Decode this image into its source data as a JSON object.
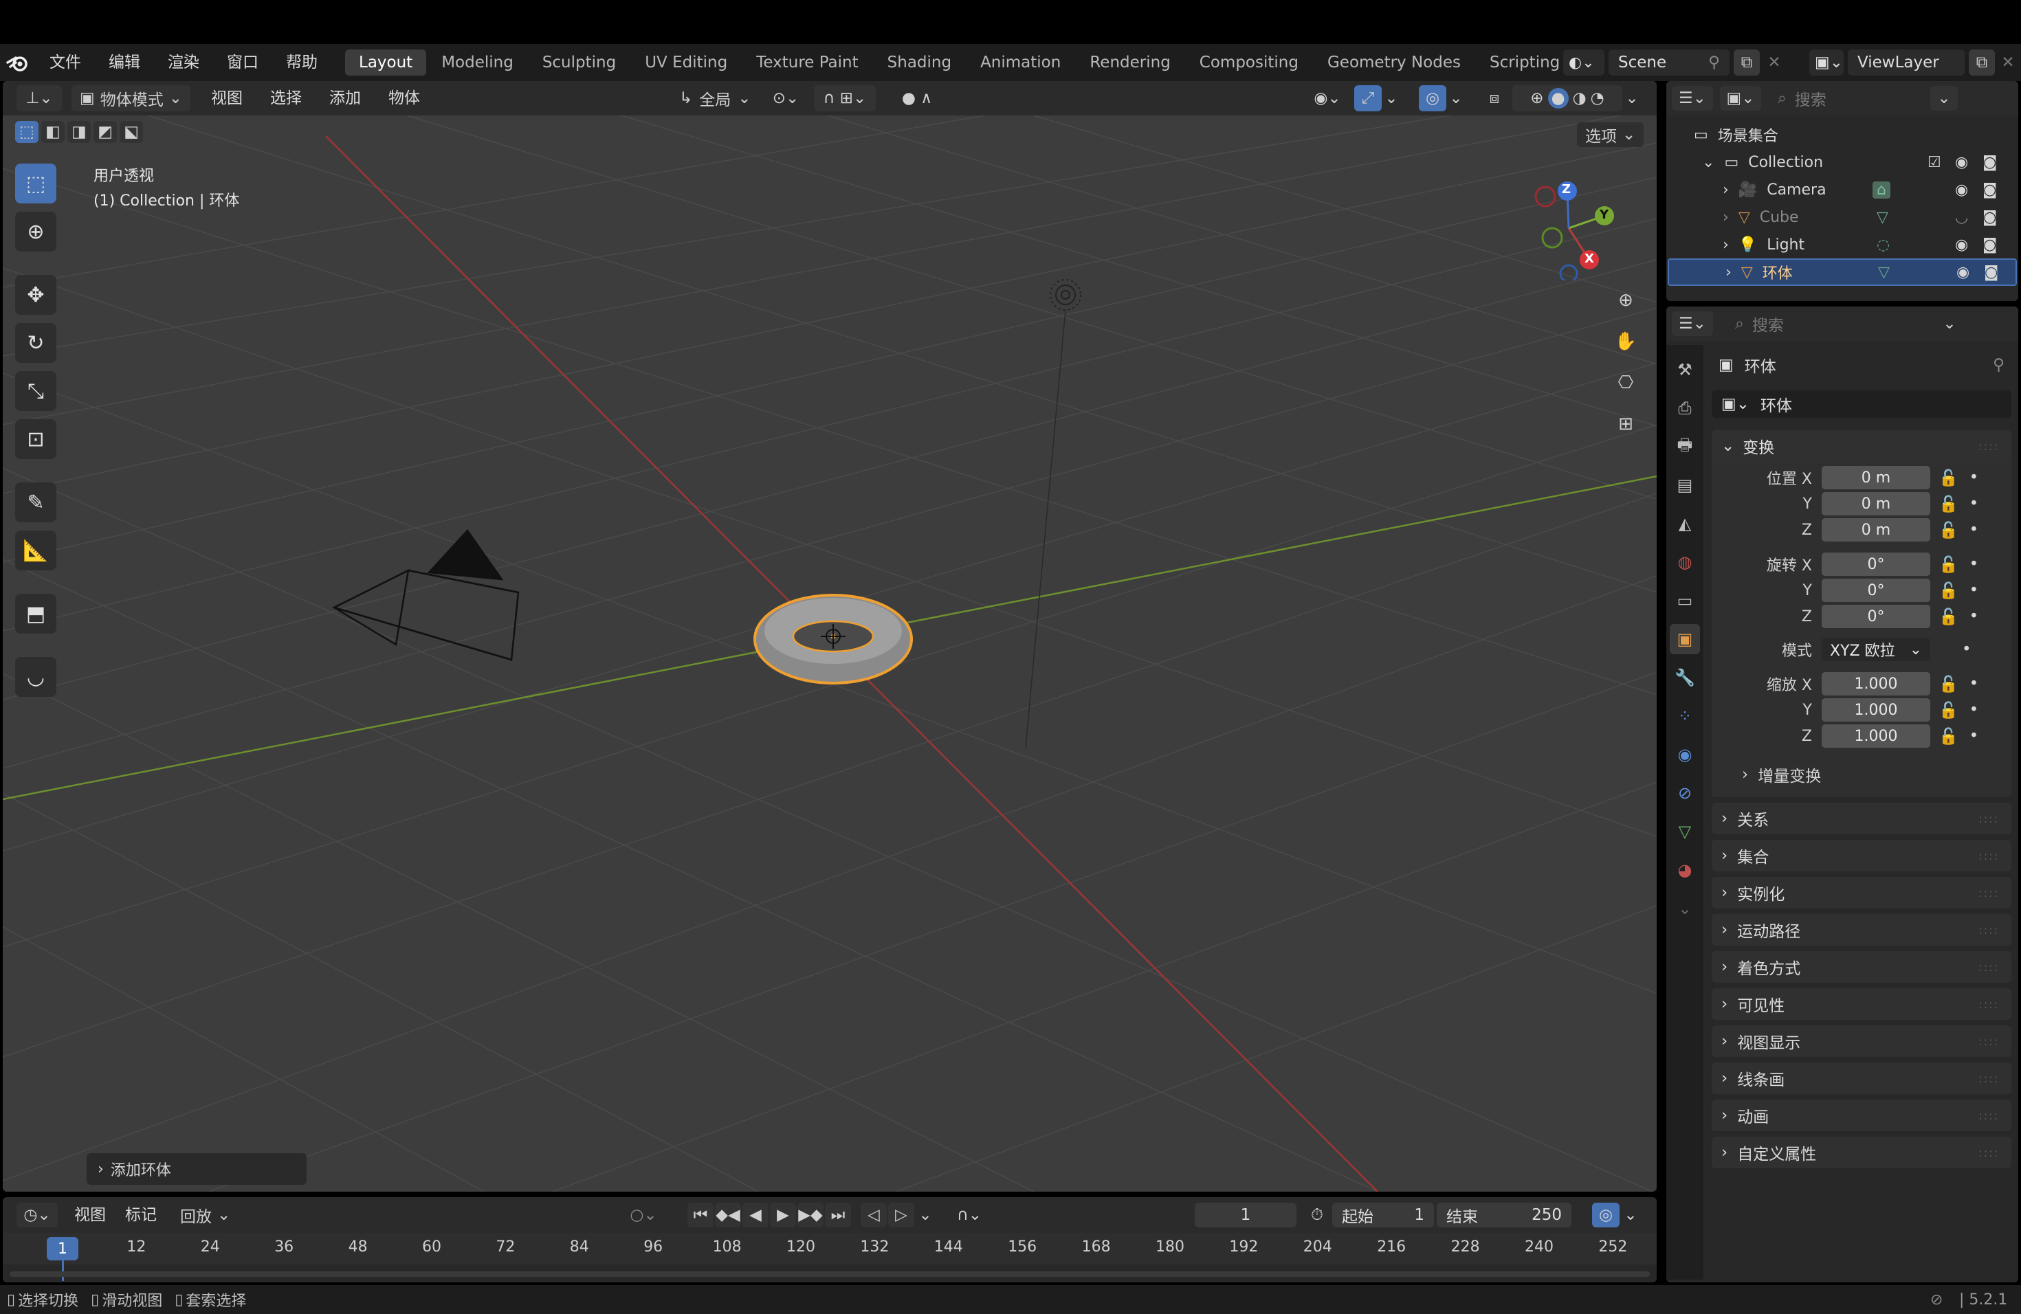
{
  "top_menu": {
    "items": [
      "文件",
      "编辑",
      "渲染",
      "窗口",
      "帮助"
    ]
  },
  "workspaces": {
    "tabs": [
      "Layout",
      "Modeling",
      "Sculpting",
      "UV Editing",
      "Texture Paint",
      "Shading",
      "Animation",
      "Rendering",
      "Compositing",
      "Geometry Nodes",
      "Scripting"
    ],
    "active": "Layout",
    "add_label": "+"
  },
  "scene": {
    "name": "Scene"
  },
  "view_layer": {
    "name": "ViewLayer"
  },
  "viewport_header": {
    "mode": "物体模式",
    "menus": [
      "视图",
      "选择",
      "添加",
      "物体"
    ],
    "orientation": "全局",
    "options_label": "选项"
  },
  "viewport": {
    "view_name": "用户透视",
    "collection_info": "(1) Collection | 环体",
    "last_op": "添加环体",
    "gizmo": {
      "z": "Z",
      "y": "Y",
      "x": "X"
    }
  },
  "outliner": {
    "search_placeholder": "搜索",
    "root": "场景集合",
    "collection": "Collection",
    "objects": [
      {
        "name": "Camera",
        "visible": true
      },
      {
        "name": "Cube",
        "visible": false
      },
      {
        "name": "Light",
        "visible": true
      },
      {
        "name": "环体",
        "visible": true,
        "selected": true
      }
    ]
  },
  "properties": {
    "search_placeholder": "搜索",
    "object_title": "环体",
    "object_name": "环体",
    "transform_title": "变换",
    "location": {
      "label": "位置 X",
      "x": "0 m",
      "y": "0 m",
      "z": "0 m"
    },
    "rotation": {
      "label": "旋转 X",
      "x": "0°",
      "y": "0°",
      "z": "0°"
    },
    "mode_label": "模式",
    "mode_value": "XYZ 欧拉",
    "scale": {
      "label": "缩放 X",
      "x": "1.000",
      "y": "1.000",
      "z": "1.000"
    },
    "axis_y": "Y",
    "axis_z": "Z",
    "delta_label": "增量变换",
    "panels": [
      "关系",
      "集合",
      "实例化",
      "运动路径",
      "着色方式",
      "可见性",
      "视图显示",
      "线条画",
      "动画",
      "自定义属性"
    ]
  },
  "timeline": {
    "menus": [
      "视图",
      "标记"
    ],
    "playback": "回放",
    "current_frame": "1",
    "start_label": "起始",
    "start_value": "1",
    "end_label": "结束",
    "end_value": "250",
    "ruler": [
      "1",
      "12",
      "24",
      "36",
      "48",
      "60",
      "72",
      "84",
      "96",
      "108",
      "120",
      "132",
      "144",
      "156",
      "168",
      "180",
      "192",
      "204",
      "216",
      "228",
      "240",
      "252"
    ]
  },
  "statusbar": {
    "hints": [
      "选择切换",
      "滑动视图",
      "套索选择"
    ],
    "version": "5.2.1"
  },
  "colors": {
    "accent": "#4772b3",
    "selection_outline": "#f0a030",
    "x_axis": "#b33c3c",
    "y_axis": "#7fae3a"
  }
}
